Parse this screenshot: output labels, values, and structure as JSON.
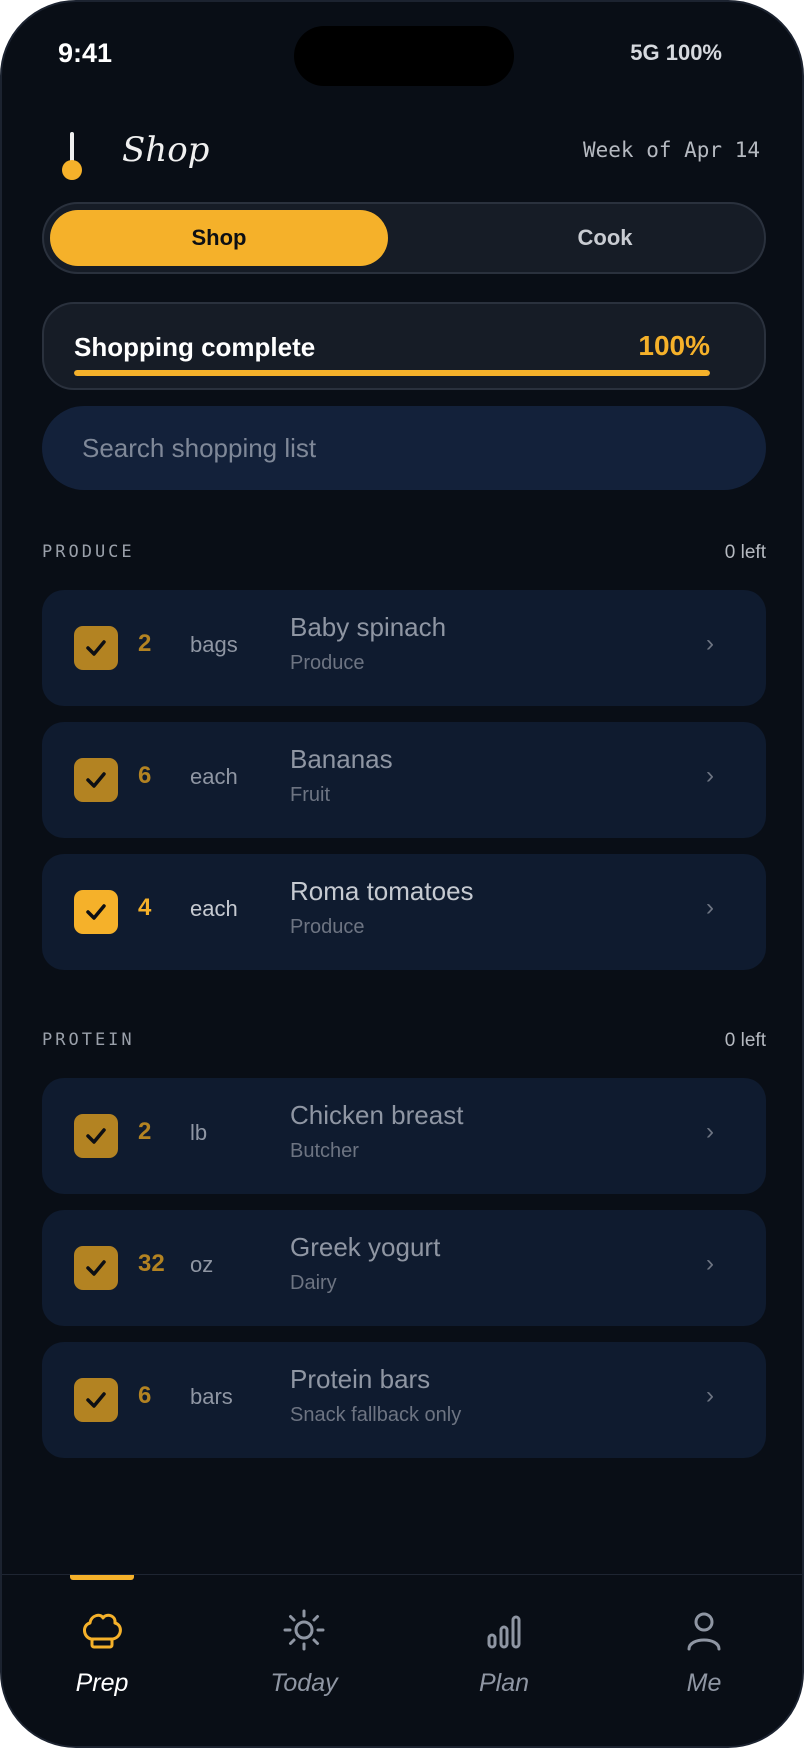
{
  "status": {
    "time": "9:41",
    "signal": "5G 100%"
  },
  "header": {
    "title": "Shop",
    "week": "Week of Apr 14"
  },
  "segments": {
    "shop": "Shop",
    "cook": "Cook"
  },
  "progress": {
    "label": "Shopping complete",
    "value_text": "100%",
    "fraction": 1.0
  },
  "search": {
    "placeholder": "Search shopping list",
    "value": ""
  },
  "sections": [
    {
      "title": "PRODUCE",
      "count": "0 left",
      "items": [
        {
          "qty": "2",
          "unit": "bags",
          "name": "Baby spinach",
          "sub": "Produce",
          "checked": true
        },
        {
          "qty": "6",
          "unit": "each",
          "name": "Bananas",
          "sub": "Fruit",
          "checked": true
        },
        {
          "qty": "4",
          "unit": "each",
          "name": "Roma tomatoes",
          "sub": "Produce",
          "checked": true
        }
      ]
    },
    {
      "title": "PROTEIN",
      "count": "0 left",
      "items": [
        {
          "qty": "2",
          "unit": "lb",
          "name": "Chicken breast",
          "sub": "Butcher",
          "checked": true
        },
        {
          "qty": "32",
          "unit": "oz",
          "name": "Greek yogurt",
          "sub": "Dairy",
          "checked": true
        },
        {
          "qty": "6",
          "unit": "bars",
          "name": "Protein bars",
          "sub": "Snack fallback only",
          "checked": true
        }
      ]
    }
  ],
  "chevron": "›",
  "tabs": [
    {
      "label": "Prep",
      "icon": "chef-hat-icon",
      "active": true
    },
    {
      "label": "Today",
      "icon": "sun-icon",
      "active": false
    },
    {
      "label": "Plan",
      "icon": "bar-chart-icon",
      "active": false
    },
    {
      "label": "Me",
      "icon": "person-icon",
      "active": false
    }
  ],
  "colors": {
    "accent": "#f5b12a",
    "background": "#090e16",
    "card": "#0f1b2f"
  }
}
